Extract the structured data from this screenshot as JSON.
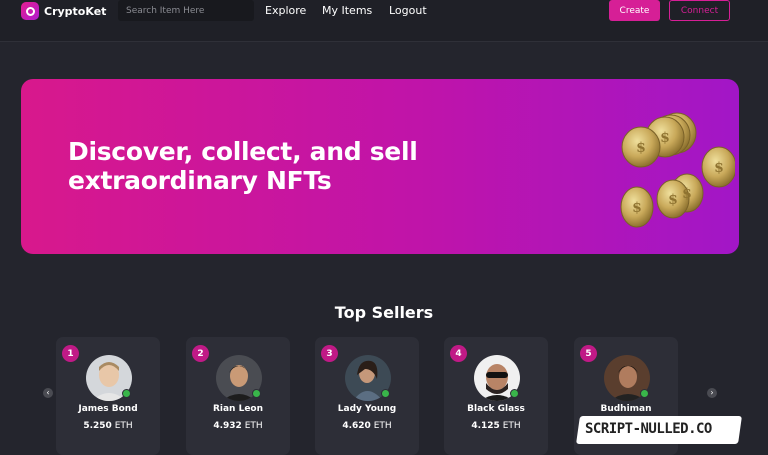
{
  "nav": {
    "brand": "CryptoKet",
    "search_placeholder": "Search Item Here",
    "links": [
      "Explore",
      "My Items",
      "Logout"
    ],
    "create_label": "Create",
    "connect_label": "Connect"
  },
  "hero": {
    "title": "Discover, collect, and sell extraordinary NFTs"
  },
  "top_sellers": {
    "title": "Top Sellers",
    "sellers": [
      {
        "rank": "1",
        "name": "James Bond",
        "amount": "5.250",
        "currency": "ETH"
      },
      {
        "rank": "2",
        "name": "Rian Leon",
        "amount": "4.932",
        "currency": "ETH"
      },
      {
        "rank": "3",
        "name": "Lady Young",
        "amount": "4.620",
        "currency": "ETH"
      },
      {
        "rank": "4",
        "name": "Black Glass",
        "amount": "4.125",
        "currency": "ETH"
      },
      {
        "rank": "5",
        "name": "Budhiman",
        "amount": "",
        "currency": ""
      }
    ]
  },
  "watermark": "SCRIPT-NULLED.CO",
  "colors": {
    "accent": "#d61f96",
    "background": "#24252d",
    "card": "#2d2e37",
    "verified": "#39b54a"
  }
}
